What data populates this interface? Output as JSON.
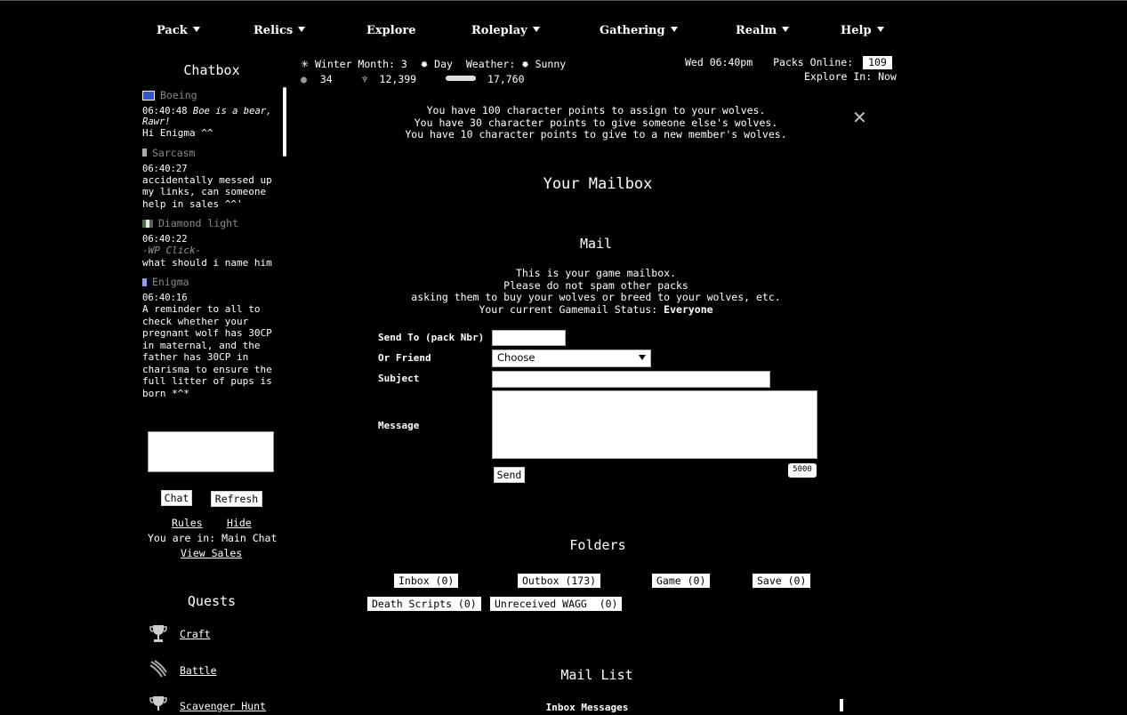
{
  "nav": [
    {
      "label": "Pack",
      "dropdown": true
    },
    {
      "label": "Relics",
      "dropdown": true
    },
    {
      "label": "Explore",
      "dropdown": false
    },
    {
      "label": "Roleplay",
      "dropdown": true
    },
    {
      "label": "Gathering",
      "dropdown": true
    },
    {
      "label": "Realm",
      "dropdown": true
    },
    {
      "label": "Help",
      "dropdown": true
    }
  ],
  "chatbox": {
    "title": "Chatbox",
    "messages": [
      {
        "user": "Boeing",
        "flag_color": "#3355cc",
        "time": "06:40:48",
        "emote": "Boe is a bear, Rawr!",
        "text": "Hi Enigma ^^"
      },
      {
        "user": "Sarcasm",
        "flag_color": "#aaaaaa",
        "time": "06:40:27",
        "emote": "",
        "text": "accidentally messed up my links, can someone help in sales ^^'"
      },
      {
        "user": "Diamond light",
        "flag_color": "#bbccbb",
        "time": "06:40:22",
        "emote_gray": "-WP Click-",
        "text": "what should i name him"
      },
      {
        "user": "Enigma",
        "flag_color": "#9999ee",
        "time": "06:40:16",
        "emote": "",
        "text": "A reminder to all to check whether your pregnant wolf has 30CP in maternal, and the father has 30CP in charisma to ensure the full litter of pups is born *^*"
      }
    ],
    "chat_button": "Chat",
    "refresh_button": "Refresh",
    "rules_link": "Rules",
    "hide_link": "Hide",
    "location_text": "You are in: Main Chat",
    "view_sales_link": "View Sales"
  },
  "quests": {
    "title": "Quests",
    "items": [
      "Craft",
      "Battle",
      "Scavenger Hunt"
    ]
  },
  "status": {
    "season": "Winter Month: 3",
    "daytime": "Day",
    "weather_label": "Weather:",
    "weather": "Sunny",
    "stat1": "34",
    "stat2": "12,399",
    "stat3": "17,760",
    "datetime": "Wed 06:40pm",
    "packs_online_label": "Packs Online:",
    "packs_online": "109",
    "explore_in": "Explore In: Now"
  },
  "cp_notice": [
    "You have 100 character points to assign to your wolves.",
    "You have 30 character points to give someone else's wolves.",
    "You have 10 character points to give to a new member's wolves."
  ],
  "mailbox": {
    "title": "Your Mailbox",
    "mail_heading": "Mail",
    "desc": [
      "This is your game mailbox.",
      "Please do not spam other packs",
      "asking them to buy your wolves or breed to your wolves, etc."
    ],
    "status_label": "Your current Gamemail Status:",
    "status_value": "Everyone",
    "send_to_label": "Send To (pack Nbr)",
    "friend_label": "Or Friend",
    "friend_selected": "Choose",
    "subject_label": "Subject",
    "message_label": "Message",
    "send_button": "Send",
    "char_counter": "5000"
  },
  "folders": {
    "title": "Folders",
    "items": [
      "Inbox (0)",
      "Outbox (173)",
      "Game (0)",
      "Save (0)",
      "Death Scripts (0)",
      "Unreceived WAGG  (0)"
    ]
  },
  "mail_list": {
    "title": "Mail List",
    "subtitle": "Inbox Messages"
  }
}
